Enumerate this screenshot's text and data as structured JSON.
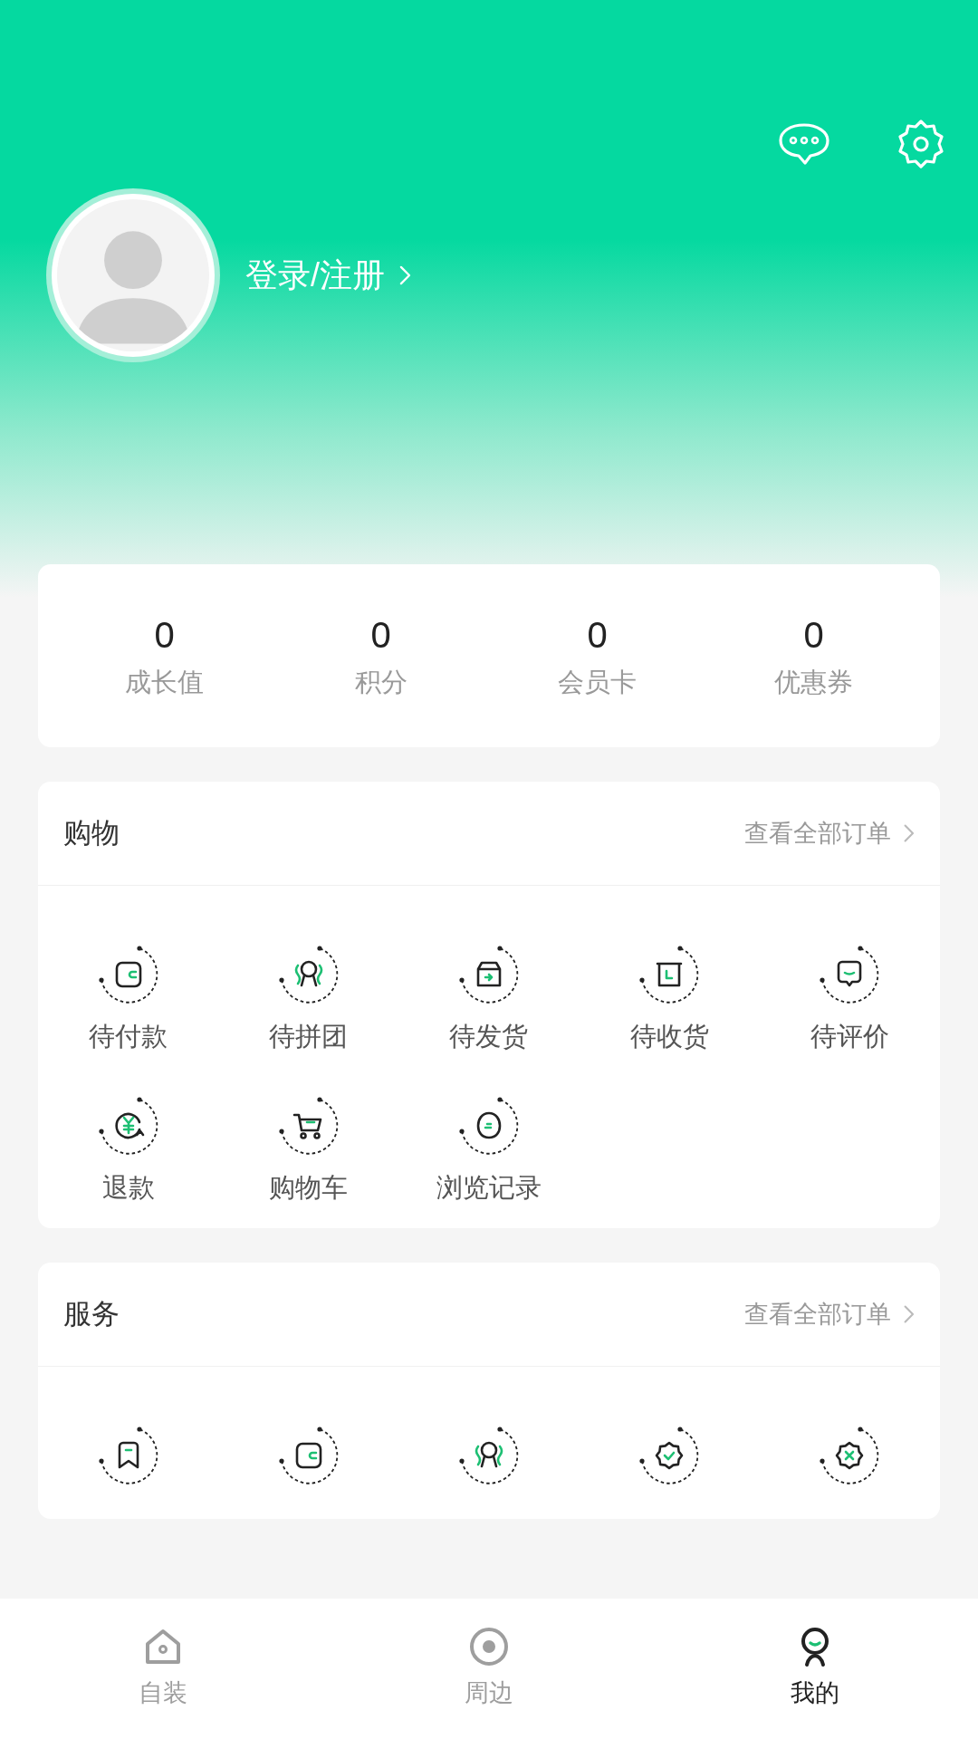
{
  "profile": {
    "login_text": "登录/注册"
  },
  "stats": [
    {
      "value": "0",
      "label": "成长值"
    },
    {
      "value": "0",
      "label": "积分"
    },
    {
      "value": "0",
      "label": "会员卡"
    },
    {
      "value": "0",
      "label": "优惠券"
    }
  ],
  "sections": [
    {
      "title": "购物",
      "link": "查看全部订单",
      "items": [
        {
          "kind": "wallet",
          "label": "待付款"
        },
        {
          "kind": "group",
          "label": "待拼团"
        },
        {
          "kind": "parcel",
          "label": "待发货"
        },
        {
          "kind": "receive",
          "label": "待收货"
        },
        {
          "kind": "review",
          "label": "待评价"
        },
        {
          "kind": "refund",
          "label": "退款"
        },
        {
          "kind": "cart",
          "label": "购物车"
        },
        {
          "kind": "history",
          "label": "浏览记录"
        }
      ]
    },
    {
      "title": "服务",
      "link": "查看全部订单",
      "items": [
        {
          "kind": "bookmark"
        },
        {
          "kind": "wallet"
        },
        {
          "kind": "group"
        },
        {
          "kind": "badge_check"
        },
        {
          "kind": "badge_cross"
        }
      ]
    }
  ],
  "bottom_nav": [
    {
      "kind": "home",
      "label": "自装",
      "selected": false
    },
    {
      "kind": "nearby",
      "label": "周边",
      "selected": false
    },
    {
      "kind": "me",
      "label": "我的",
      "selected": true
    }
  ]
}
